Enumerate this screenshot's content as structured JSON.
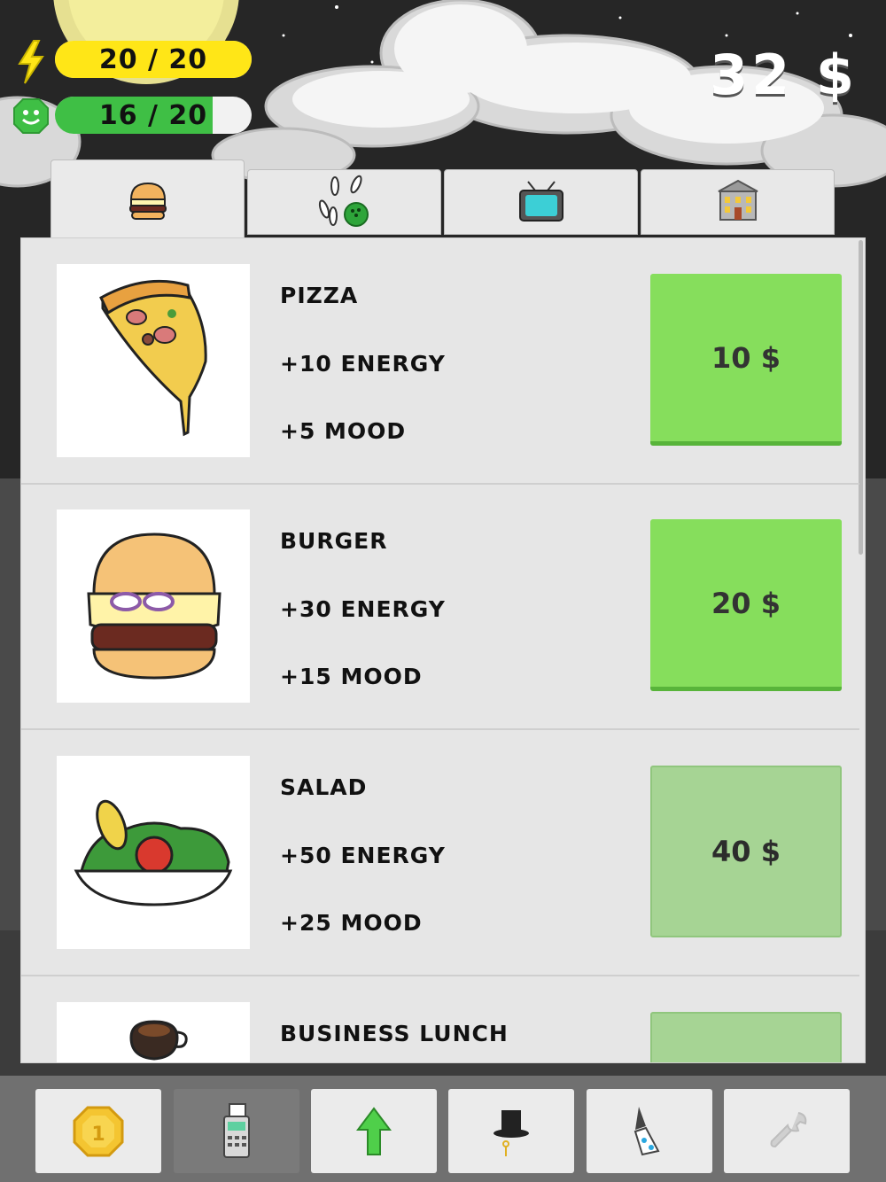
{
  "hud": {
    "energy_text": "20 / 20",
    "energy_fraction": 1.0,
    "mood_text": "16 / 20",
    "mood_fraction": 0.8,
    "money": "32 $",
    "energy_icon": "lightning-icon",
    "mood_icon": "smiley-icon"
  },
  "tabs": [
    {
      "icon": "burger-icon",
      "active": true
    },
    {
      "icon": "bowling-icon",
      "active": false
    },
    {
      "icon": "tv-icon",
      "active": false
    },
    {
      "icon": "bank-icon",
      "active": false
    }
  ],
  "items": [
    {
      "name": "PIZZA",
      "energy": "+10 ENERGY",
      "mood": "+5 MOOD",
      "price": "10 $",
      "affordable": true,
      "icon": "pizza-icon"
    },
    {
      "name": "BURGER",
      "energy": "+30 ENERGY",
      "mood": "+15 MOOD",
      "price": "20 $",
      "affordable": true,
      "icon": "burger-icon"
    },
    {
      "name": "SALAD",
      "energy": "+50 ENERGY",
      "mood": "+25 MOOD",
      "price": "40 $",
      "affordable": false,
      "icon": "salad-icon"
    },
    {
      "name": "BUSINESS LUNCH",
      "energy": "",
      "mood": "",
      "price": "",
      "affordable": false,
      "icon": "coffee-icon"
    }
  ],
  "bottom_nav": [
    {
      "icon": "coin-icon",
      "selected": false
    },
    {
      "icon": "payment-terminal-icon",
      "selected": true
    },
    {
      "icon": "arrow-up-icon",
      "selected": false
    },
    {
      "icon": "top-hat-icon",
      "selected": false
    },
    {
      "icon": "party-hat-icon",
      "selected": false
    },
    {
      "icon": "wrench-icon",
      "selected": false
    }
  ],
  "colors": {
    "energy": "#ffe617",
    "mood": "#3fbf45",
    "buy_enabled": "#86de5c",
    "buy_disabled": "#a6d494"
  }
}
